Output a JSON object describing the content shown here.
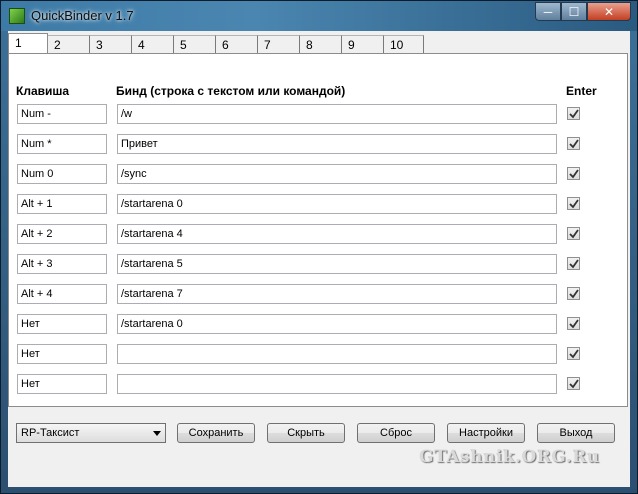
{
  "window": {
    "title": "QuickBinder v 1.7",
    "min_glyph": "─",
    "max_glyph": "☐",
    "close_glyph": "✕"
  },
  "tabs": [
    "1",
    "2",
    "3",
    "4",
    "5",
    "6",
    "7",
    "8",
    "9",
    "10"
  ],
  "headers": {
    "key": "Клавиша",
    "bind": "Бинд (строка с текстом или командой)",
    "enter": "Enter"
  },
  "rows": [
    {
      "key": "Num -",
      "bind": "/w",
      "enter": true
    },
    {
      "key": "Num *",
      "bind": "Привет",
      "enter": true
    },
    {
      "key": "Num 0",
      "bind": "/sync",
      "enter": true
    },
    {
      "key": "Alt + 1",
      "bind": "/startarena 0",
      "enter": true
    },
    {
      "key": "Alt + 2",
      "bind": "/startarena 4",
      "enter": true
    },
    {
      "key": "Alt + 3",
      "bind": "/startarena 5",
      "enter": true
    },
    {
      "key": "Alt + 4",
      "bind": "/startarena 7",
      "enter": true
    },
    {
      "key": "Нет",
      "bind": "/startarena 0",
      "enter": true
    },
    {
      "key": "Нет",
      "bind": "",
      "enter": true
    },
    {
      "key": "Нет",
      "bind": "",
      "enter": true
    }
  ],
  "profile": {
    "selected": "RP-Таксист"
  },
  "buttons": {
    "save": "Сохранить",
    "hide": "Скрыть",
    "reset": "Сброс",
    "settings": "Настройки",
    "exit": "Выход"
  },
  "watermark": "GTAshnik.ORG.Ru"
}
